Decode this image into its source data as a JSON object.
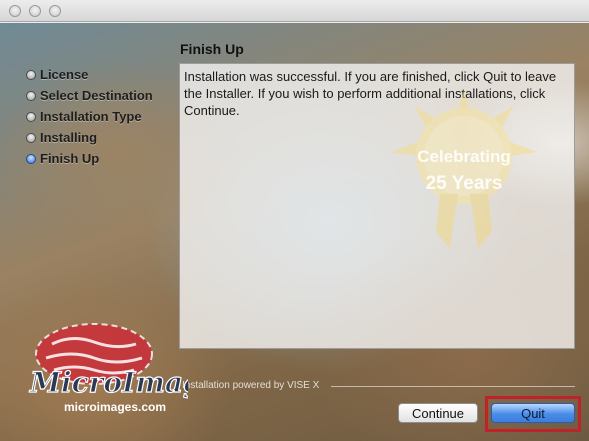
{
  "steps": [
    {
      "label": "License",
      "active": false
    },
    {
      "label": "Select Destination",
      "active": false
    },
    {
      "label": "Installation Type",
      "active": false
    },
    {
      "label": "Installing",
      "active": false
    },
    {
      "label": "Finish Up",
      "active": true
    }
  ],
  "main": {
    "heading": "Finish Up",
    "message": "Installation was successful. If you are finished, click Quit to leave the Installer. If you wish to perform additional installations, click Continue."
  },
  "badge": {
    "line1": "Celebrating",
    "line2": "25 Years"
  },
  "footer": {
    "powered_by": "Installation powered by VISE X"
  },
  "logo": {
    "name": "MicroImages",
    "url_text": "microimages.com"
  },
  "buttons": {
    "continue_label": "Continue",
    "quit_label": "Quit"
  },
  "colors": {
    "accent": "#3b7ee0",
    "highlight": "#c0222a"
  }
}
